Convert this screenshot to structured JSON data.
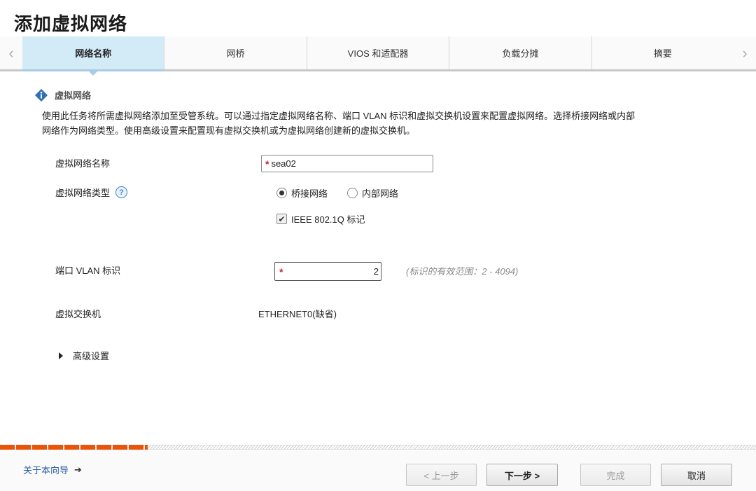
{
  "window": {
    "title": "添加虚拟网络"
  },
  "tabs": [
    {
      "label": "网络名称",
      "active": true
    },
    {
      "label": "网桥",
      "active": false
    },
    {
      "label": "VIOS 和适配器",
      "active": false
    },
    {
      "label": "负载分摊",
      "active": false
    },
    {
      "label": "摘要",
      "active": false
    }
  ],
  "section": {
    "title": "虚拟网络",
    "description": "使用此任务将所需虚拟网络添加至受管系统。可以通过指定虚拟网络名称、端口 VLAN 标识和虚拟交换机设置来配置虚拟网络。选择桥接网络或内部网络作为网络类型。使用高级设置来配置现有虚拟交换机或为虚拟网络创建新的虚拟交换机。"
  },
  "form": {
    "name_label": "虚拟网络名称",
    "name_value": "sea02",
    "required_mark": "*",
    "type_label": "虚拟网络类型",
    "help_glyph": "?",
    "radio_bridged": "桥接网络",
    "radio_internal": "内部网络",
    "radio_selected": "bridged",
    "ieee_label": "IEEE 802.1Q 标记",
    "ieee_checked": true,
    "vlan_label": "端口 VLAN 标识",
    "vlan_value": "2",
    "vlan_hint": "(标识的有效范围：2 - 4094)",
    "switch_label": "虚拟交换机",
    "switch_value": "ETHERNET0(缺省)",
    "advanced_label": "高级设置"
  },
  "progress": {
    "fraction": 0.2
  },
  "footer": {
    "about_label": "关于本向导",
    "prev_label": "< 上一步",
    "next_label": "下一步 >",
    "finish_label": "完成",
    "cancel_label": "取消"
  },
  "colors": {
    "active_tab": "#d3ebf7",
    "progress": "#e8540a",
    "required": "#d0202e",
    "link": "#2c5f9e"
  }
}
